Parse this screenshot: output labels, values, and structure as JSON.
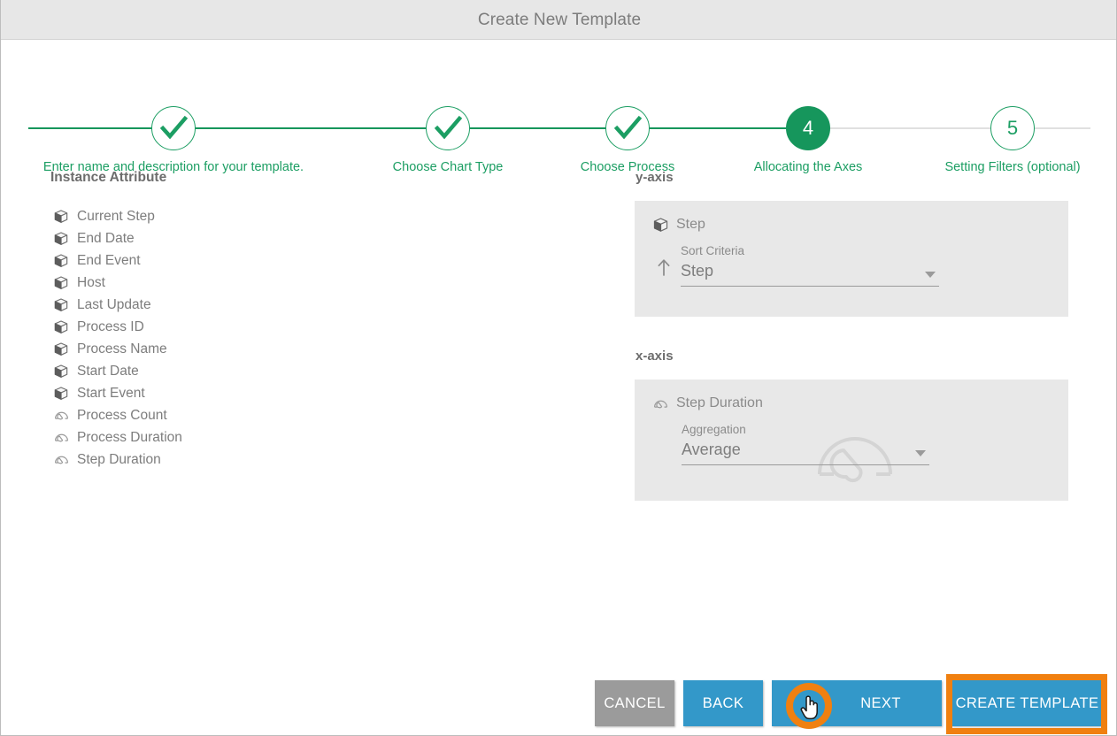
{
  "window": {
    "title": "Create New Template"
  },
  "stepper": {
    "steps": [
      {
        "label": "Enter name and description for your template.",
        "number": "1",
        "state": "done"
      },
      {
        "label": "Choose Chart Type",
        "number": "2",
        "state": "done"
      },
      {
        "label": "Choose Process",
        "number": "3",
        "state": "done"
      },
      {
        "label": "Allocating the Axes",
        "number": "4",
        "state": "current"
      },
      {
        "label": "Setting Filters (optional)",
        "number": "5",
        "state": "todo"
      }
    ],
    "colors": {
      "done": "#16965c",
      "current": "#16965c",
      "todo_rail": "#e0e0e0",
      "label": "#1c9e63"
    }
  },
  "attributes": {
    "title": "Instance Attribute",
    "items": [
      {
        "label": "Current Step",
        "icon": "cube-icon"
      },
      {
        "label": "End Date",
        "icon": "cube-icon"
      },
      {
        "label": "End Event",
        "icon": "cube-icon"
      },
      {
        "label": "Host",
        "icon": "cube-icon"
      },
      {
        "label": "Last Update",
        "icon": "cube-icon"
      },
      {
        "label": "Process ID",
        "icon": "cube-icon"
      },
      {
        "label": "Process Name",
        "icon": "cube-icon"
      },
      {
        "label": "Start Date",
        "icon": "cube-icon"
      },
      {
        "label": "Start Event",
        "icon": "cube-icon"
      },
      {
        "label": "Process Count",
        "icon": "gauge-icon"
      },
      {
        "label": "Process Duration",
        "icon": "gauge-icon"
      },
      {
        "label": "Step Duration",
        "icon": "gauge-icon"
      }
    ]
  },
  "yaxis": {
    "title": "y-axis",
    "field_name": "Step",
    "field_icon": "cube-icon",
    "sort_direction_icon": "arrow-up-icon",
    "select_label": "Sort Criteria",
    "select_value": "Step",
    "select_caret_icon": "chevron-down-icon"
  },
  "xaxis": {
    "title": "x-axis",
    "field_name": "Step Duration",
    "field_icon": "gauge-icon",
    "watermark_icon": "gauge-icon",
    "select_label": "Aggregation",
    "select_value": "Average",
    "select_caret_icon": "chevron-down-icon"
  },
  "footer": {
    "cancel_label": "CANCEL",
    "back_label": "BACK",
    "next_label": "NEXT",
    "create_label": "CREATE TEMPLATE",
    "colors": {
      "cancel": "#9b9b9b",
      "primary": "#3398c9",
      "highlight": "#f08010"
    }
  },
  "annotations": {
    "cursor_icon": "pointing-hand-cursor",
    "highlight_target": "CREATE TEMPLATE"
  }
}
